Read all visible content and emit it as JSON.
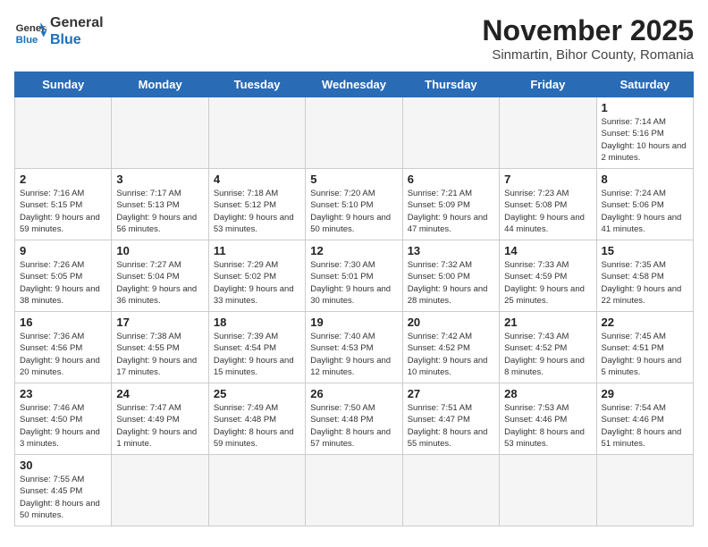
{
  "header": {
    "logo_general": "General",
    "logo_blue": "Blue",
    "month": "November 2025",
    "location": "Sinmartin, Bihor County, Romania"
  },
  "days_of_week": [
    "Sunday",
    "Monday",
    "Tuesday",
    "Wednesday",
    "Thursday",
    "Friday",
    "Saturday"
  ],
  "weeks": [
    [
      {
        "day": "",
        "info": ""
      },
      {
        "day": "",
        "info": ""
      },
      {
        "day": "",
        "info": ""
      },
      {
        "day": "",
        "info": ""
      },
      {
        "day": "",
        "info": ""
      },
      {
        "day": "",
        "info": ""
      },
      {
        "day": "1",
        "info": "Sunrise: 7:14 AM\nSunset: 5:16 PM\nDaylight: 10 hours\nand 2 minutes."
      }
    ],
    [
      {
        "day": "2",
        "info": "Sunrise: 7:16 AM\nSunset: 5:15 PM\nDaylight: 9 hours\nand 59 minutes."
      },
      {
        "day": "3",
        "info": "Sunrise: 7:17 AM\nSunset: 5:13 PM\nDaylight: 9 hours\nand 56 minutes."
      },
      {
        "day": "4",
        "info": "Sunrise: 7:18 AM\nSunset: 5:12 PM\nDaylight: 9 hours\nand 53 minutes."
      },
      {
        "day": "5",
        "info": "Sunrise: 7:20 AM\nSunset: 5:10 PM\nDaylight: 9 hours\nand 50 minutes."
      },
      {
        "day": "6",
        "info": "Sunrise: 7:21 AM\nSunset: 5:09 PM\nDaylight: 9 hours\nand 47 minutes."
      },
      {
        "day": "7",
        "info": "Sunrise: 7:23 AM\nSunset: 5:08 PM\nDaylight: 9 hours\nand 44 minutes."
      },
      {
        "day": "8",
        "info": "Sunrise: 7:24 AM\nSunset: 5:06 PM\nDaylight: 9 hours\nand 41 minutes."
      }
    ],
    [
      {
        "day": "9",
        "info": "Sunrise: 7:26 AM\nSunset: 5:05 PM\nDaylight: 9 hours\nand 38 minutes."
      },
      {
        "day": "10",
        "info": "Sunrise: 7:27 AM\nSunset: 5:04 PM\nDaylight: 9 hours\nand 36 minutes."
      },
      {
        "day": "11",
        "info": "Sunrise: 7:29 AM\nSunset: 5:02 PM\nDaylight: 9 hours\nand 33 minutes."
      },
      {
        "day": "12",
        "info": "Sunrise: 7:30 AM\nSunset: 5:01 PM\nDaylight: 9 hours\nand 30 minutes."
      },
      {
        "day": "13",
        "info": "Sunrise: 7:32 AM\nSunset: 5:00 PM\nDaylight: 9 hours\nand 28 minutes."
      },
      {
        "day": "14",
        "info": "Sunrise: 7:33 AM\nSunset: 4:59 PM\nDaylight: 9 hours\nand 25 minutes."
      },
      {
        "day": "15",
        "info": "Sunrise: 7:35 AM\nSunset: 4:58 PM\nDaylight: 9 hours\nand 22 minutes."
      }
    ],
    [
      {
        "day": "16",
        "info": "Sunrise: 7:36 AM\nSunset: 4:56 PM\nDaylight: 9 hours\nand 20 minutes."
      },
      {
        "day": "17",
        "info": "Sunrise: 7:38 AM\nSunset: 4:55 PM\nDaylight: 9 hours\nand 17 minutes."
      },
      {
        "day": "18",
        "info": "Sunrise: 7:39 AM\nSunset: 4:54 PM\nDaylight: 9 hours\nand 15 minutes."
      },
      {
        "day": "19",
        "info": "Sunrise: 7:40 AM\nSunset: 4:53 PM\nDaylight: 9 hours\nand 12 minutes."
      },
      {
        "day": "20",
        "info": "Sunrise: 7:42 AM\nSunset: 4:52 PM\nDaylight: 9 hours\nand 10 minutes."
      },
      {
        "day": "21",
        "info": "Sunrise: 7:43 AM\nSunset: 4:52 PM\nDaylight: 9 hours\nand 8 minutes."
      },
      {
        "day": "22",
        "info": "Sunrise: 7:45 AM\nSunset: 4:51 PM\nDaylight: 9 hours\nand 5 minutes."
      }
    ],
    [
      {
        "day": "23",
        "info": "Sunrise: 7:46 AM\nSunset: 4:50 PM\nDaylight: 9 hours\nand 3 minutes."
      },
      {
        "day": "24",
        "info": "Sunrise: 7:47 AM\nSunset: 4:49 PM\nDaylight: 9 hours\nand 1 minute."
      },
      {
        "day": "25",
        "info": "Sunrise: 7:49 AM\nSunset: 4:48 PM\nDaylight: 8 hours\nand 59 minutes."
      },
      {
        "day": "26",
        "info": "Sunrise: 7:50 AM\nSunset: 4:48 PM\nDaylight: 8 hours\nand 57 minutes."
      },
      {
        "day": "27",
        "info": "Sunrise: 7:51 AM\nSunset: 4:47 PM\nDaylight: 8 hours\nand 55 minutes."
      },
      {
        "day": "28",
        "info": "Sunrise: 7:53 AM\nSunset: 4:46 PM\nDaylight: 8 hours\nand 53 minutes."
      },
      {
        "day": "29",
        "info": "Sunrise: 7:54 AM\nSunset: 4:46 PM\nDaylight: 8 hours\nand 51 minutes."
      }
    ],
    [
      {
        "day": "30",
        "info": "Sunrise: 7:55 AM\nSunset: 4:45 PM\nDaylight: 8 hours\nand 50 minutes."
      },
      {
        "day": "",
        "info": ""
      },
      {
        "day": "",
        "info": ""
      },
      {
        "day": "",
        "info": ""
      },
      {
        "day": "",
        "info": ""
      },
      {
        "day": "",
        "info": ""
      },
      {
        "day": "",
        "info": ""
      }
    ]
  ]
}
